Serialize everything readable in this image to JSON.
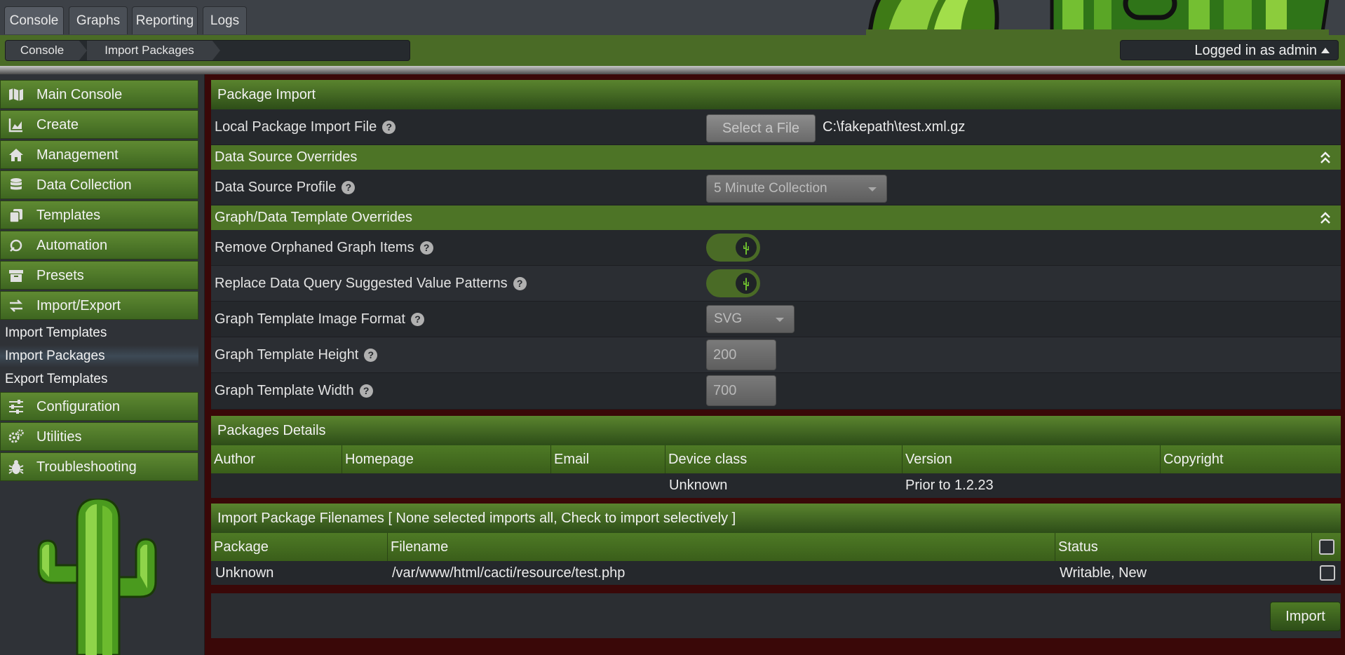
{
  "top_tabs": [
    {
      "label": "Console",
      "active": true
    },
    {
      "label": "Graphs",
      "active": false
    },
    {
      "label": "Reporting",
      "active": false
    },
    {
      "label": "Logs",
      "active": false
    }
  ],
  "breadcrumb": [
    "Console",
    "Import Packages"
  ],
  "user": {
    "label": "Logged in as admin"
  },
  "sidebar": {
    "items": [
      {
        "label": "Main Console",
        "icon": "map-icon"
      },
      {
        "label": "Create",
        "icon": "area-chart-icon"
      },
      {
        "label": "Management",
        "icon": "home-icon"
      },
      {
        "label": "Data Collection",
        "icon": "database-icon"
      },
      {
        "label": "Templates",
        "icon": "copy-icon"
      },
      {
        "label": "Automation",
        "icon": "automation-icon"
      },
      {
        "label": "Presets",
        "icon": "archive-icon"
      },
      {
        "label": "Import/Export",
        "icon": "exchange-icon"
      }
    ],
    "sub_items": [
      {
        "label": "Import Templates",
        "selected": false
      },
      {
        "label": "Import Packages",
        "selected": true
      },
      {
        "label": "Export Templates",
        "selected": false
      }
    ],
    "items_after": [
      {
        "label": "Configuration",
        "icon": "sliders-icon"
      },
      {
        "label": "Utilities",
        "icon": "cogs-icon"
      },
      {
        "label": "Troubleshooting",
        "icon": "bug-icon"
      }
    ]
  },
  "package_import": {
    "title": "Package Import",
    "file_row": {
      "label": "Local Package Import File",
      "button": "Select a File",
      "value": "C:\\fakepath\\test.xml.gz"
    },
    "ds_overrides": {
      "title": "Data Source Overrides",
      "profile_label": "Data Source Profile",
      "profile_value": "5 Minute Collection"
    },
    "graph_overrides": {
      "title": "Graph/Data Template Overrides",
      "remove_orphaned_label": "Remove Orphaned Graph Items",
      "remove_orphaned_on": true,
      "replace_patterns_label": "Replace Data Query Suggested Value Patterns",
      "replace_patterns_on": true,
      "image_format_label": "Graph Template Image Format",
      "image_format_value": "SVG",
      "height_label": "Graph Template Height",
      "height_value": "200",
      "width_label": "Graph Template Width",
      "width_value": "700"
    }
  },
  "package_details": {
    "title": "Packages Details",
    "columns": [
      "Author",
      "Homepage",
      "Email",
      "Device class",
      "Version",
      "Copyright"
    ],
    "row": [
      "",
      "",
      "",
      "Unknown",
      "Prior to 1.2.23",
      ""
    ]
  },
  "filenames": {
    "title": "Import Package Filenames [ None selected imports all, Check to import selectively ]",
    "columns": [
      "Package",
      "Filename",
      "Status"
    ],
    "row": [
      "Unknown",
      "/var/www/html/cacti/resource/test.php",
      "Writable, New"
    ]
  },
  "actions": {
    "import_label": "Import"
  },
  "colors": {
    "accent_green": "#4d7426",
    "background_dark": "#2b2e32",
    "content_bg": "#3a0808"
  }
}
